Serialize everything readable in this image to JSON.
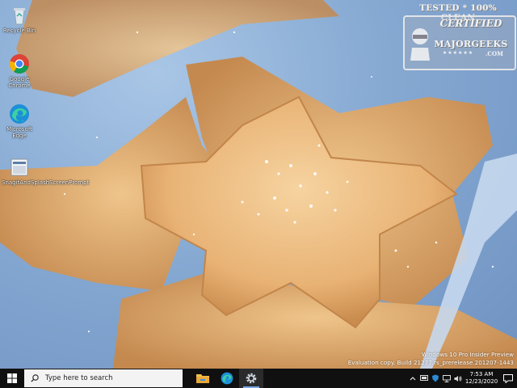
{
  "desktop": {
    "icons": [
      {
        "label": "Recycle Bin",
        "icon": "recycle-bin-icon"
      },
      {
        "label": "Google Chrome",
        "icon": "chrome-icon"
      },
      {
        "label": "Microsoft Edge",
        "icon": "edge-icon"
      },
      {
        "label": "SnagitAndSplashScreenPrompt",
        "icon": "snagit-icon"
      }
    ],
    "wallpaper": "star-cookies"
  },
  "watermark": {
    "top": "TESTED * 100% CLEAN",
    "certified": "CERTIFIED",
    "brand": "MAJORGEEKS",
    "stars": "★★★★★★",
    "suffix": ".COM"
  },
  "evaluation": {
    "line1": "Windows 10 Pro Insider Preview",
    "line2": "Evaluation copy. Build 21277.rs_prerelease.201207-1443"
  },
  "taskbar": {
    "search_placeholder": "Type here to search",
    "apps": [
      {
        "name": "file-explorer",
        "icon": "folder-icon"
      },
      {
        "name": "edge",
        "icon": "edge-icon"
      },
      {
        "name": "settings",
        "icon": "gear-icon",
        "active": true
      }
    ],
    "clock": {
      "time": "7:53 AM",
      "date": "12/23/2020"
    }
  },
  "colors": {
    "taskbar": "#101010",
    "accent": "#7aa7e0",
    "wallpaper_blue": "#86a9d2",
    "cookie": "#e9b778"
  }
}
